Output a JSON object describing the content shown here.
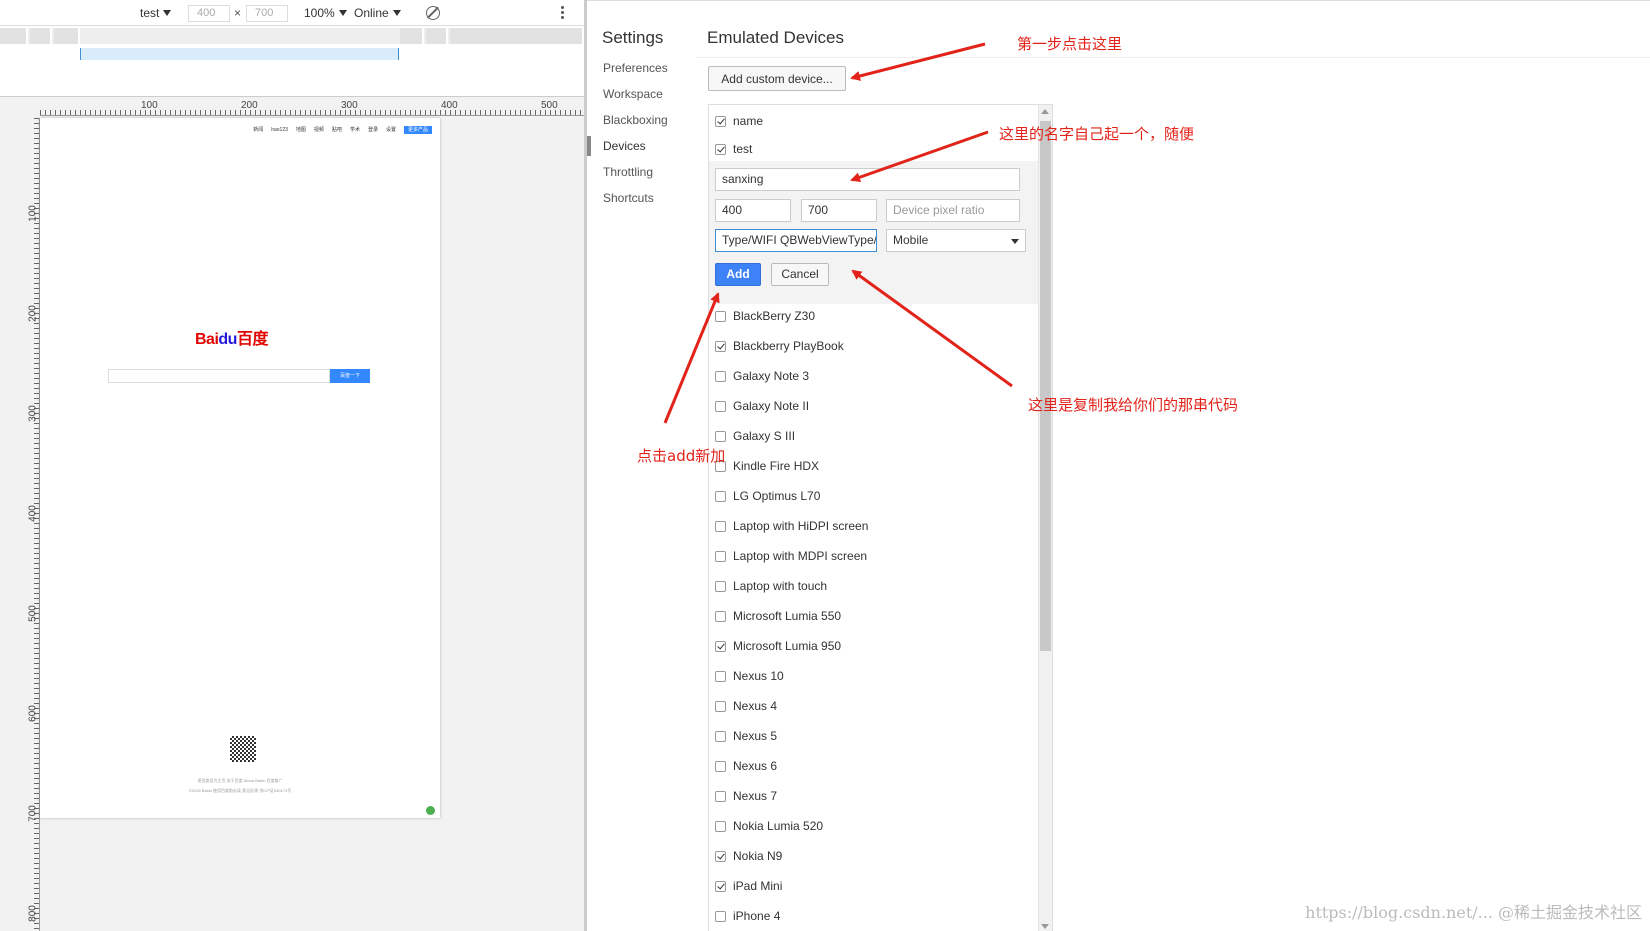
{
  "device_toolbar": {
    "device": "test",
    "width": "400",
    "times": "×",
    "height": "700",
    "zoom": "100%",
    "throttle": "Online"
  },
  "rulers": {
    "top": [
      "100",
      "200",
      "300",
      "400",
      "500"
    ],
    "left": [
      "100",
      "200",
      "300",
      "400",
      "500",
      "600",
      "700",
      "800"
    ]
  },
  "settings": {
    "title": "Settings",
    "nav": [
      "Preferences",
      "Workspace",
      "Blackboxing",
      "Devices",
      "Throttling",
      "Shortcuts"
    ],
    "active_nav": "Devices"
  },
  "emulated": {
    "title": "Emulated Devices",
    "add_custom_label": "Add custom device...",
    "custom_items": [
      {
        "label": "name",
        "checked": true
      },
      {
        "label": "test",
        "checked": true
      }
    ],
    "editor": {
      "name_value": "sanxing",
      "width_value": "400",
      "height_value": "700",
      "dpr_placeholder": "Device pixel ratio",
      "ua_value": "Type/WIFI QBWebViewType/1",
      "type_value": "Mobile",
      "add_label": "Add",
      "cancel_label": "Cancel"
    },
    "devices": [
      {
        "label": "BlackBerry Z30",
        "checked": false
      },
      {
        "label": "Blackberry PlayBook",
        "checked": true
      },
      {
        "label": "Galaxy Note 3",
        "checked": false
      },
      {
        "label": "Galaxy Note II",
        "checked": false
      },
      {
        "label": "Galaxy S III",
        "checked": false
      },
      {
        "label": "Kindle Fire HDX",
        "checked": false
      },
      {
        "label": "LG Optimus L70",
        "checked": false
      },
      {
        "label": "Laptop with HiDPI screen",
        "checked": false
      },
      {
        "label": "Laptop with MDPI screen",
        "checked": false
      },
      {
        "label": "Laptop with touch",
        "checked": false
      },
      {
        "label": "Microsoft Lumia 550",
        "checked": false
      },
      {
        "label": "Microsoft Lumia 950",
        "checked": true
      },
      {
        "label": "Nexus 10",
        "checked": false
      },
      {
        "label": "Nexus 4",
        "checked": false
      },
      {
        "label": "Nexus 5",
        "checked": false
      },
      {
        "label": "Nexus 6",
        "checked": false
      },
      {
        "label": "Nexus 7",
        "checked": false
      },
      {
        "label": "Nokia Lumia 520",
        "checked": false
      },
      {
        "label": "Nokia N9",
        "checked": true
      },
      {
        "label": "iPad Mini",
        "checked": true
      },
      {
        "label": "iPhone 4",
        "checked": false
      }
    ]
  },
  "annotations": {
    "step1": "第一步点击这里",
    "name": "这里的名字自己起一个，随便",
    "code": "这里是复制我给你们的那串代码",
    "add": "点击add新加",
    "color": "#e2231a"
  },
  "baidu": {
    "nav": [
      "新闻",
      "hao123",
      "地图",
      "视频",
      "贴吧",
      "学术",
      "登录",
      "设置",
      "更多产品"
    ],
    "logo_left": "Bai",
    "logo_mid": "du",
    "logo_right": "百度",
    "search_btn": "百度一下",
    "footer_line1": "把百度设为主页   关于百度   About Baidu   百度推广",
    "footer_line2": "©2018 Baidu 使用百度前必读 意见反馈 京ICP证030173号"
  },
  "watermark": "https://blog.csdn.net/... @稀土掘金技术社区"
}
